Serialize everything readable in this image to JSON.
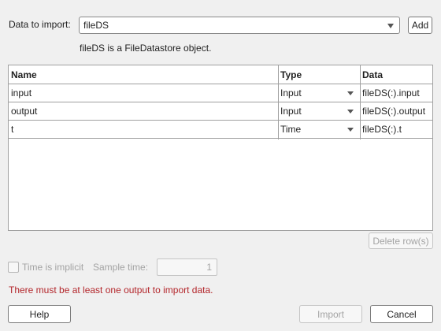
{
  "source": {
    "label": "Data to import:",
    "selected": "fileDS",
    "add_label": "Add",
    "info": "fileDS is a FileDatastore object."
  },
  "table": {
    "headers": {
      "name": "Name",
      "type": "Type",
      "data": "Data"
    },
    "rows": [
      {
        "name": "input",
        "type": "Input",
        "data": "fileDS(:).input"
      },
      {
        "name": "output",
        "type": "Input",
        "data": "fileDS(:).output"
      },
      {
        "name": "t",
        "type": "Time",
        "data": "fileDS(:).t"
      }
    ],
    "delete_label": "Delete row(s)"
  },
  "time": {
    "implicit_label": "Time is implicit",
    "implicit_checked": false,
    "sample_time_label": "Sample time:",
    "sample_time_value": "1"
  },
  "error": "There must be at least one output to import data.",
  "colors": {
    "error": "#b3262b",
    "disabled": "#a3a3a3",
    "background": "#f0f0f0"
  },
  "buttons": {
    "help": "Help",
    "import": "Import",
    "cancel": "Cancel"
  }
}
